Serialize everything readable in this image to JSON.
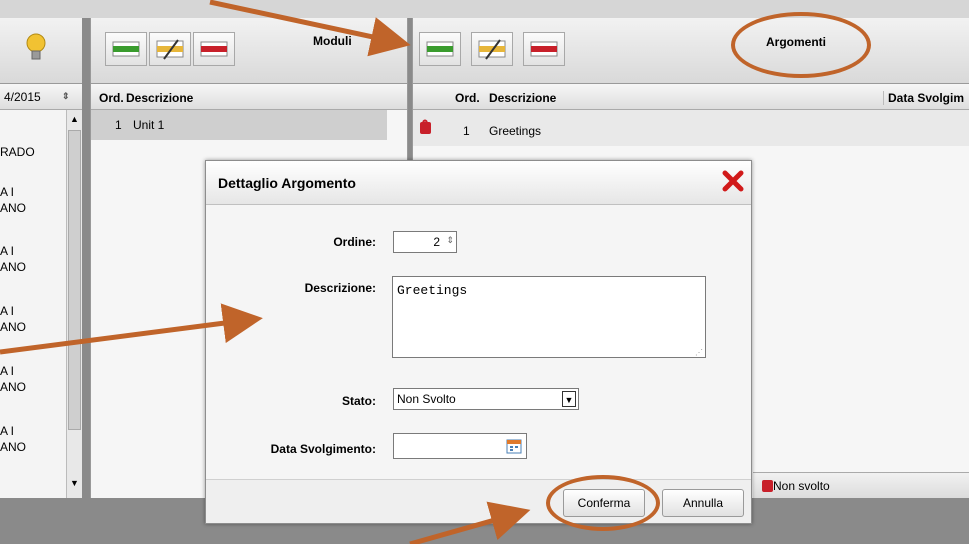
{
  "left_panel": {
    "date_value": "4/2015",
    "items": [
      "RADO",
      "A I",
      "ANO",
      "A I",
      "ANO",
      "A I",
      "ANO",
      "A I",
      "ANO",
      "A I",
      "ANO"
    ]
  },
  "moduli": {
    "title": "Moduli",
    "col_ord": "Ord.",
    "col_desc": "Descrizione",
    "rows": [
      {
        "ord": "1",
        "desc": "Unit 1"
      }
    ]
  },
  "argomenti": {
    "title": "Argomenti",
    "col_ord": "Ord.",
    "col_desc": "Descrizione",
    "col_date": "Data Svolgim",
    "rows": [
      {
        "ord": "1",
        "desc": "Greetings"
      }
    ],
    "legend_label": "Non svolto"
  },
  "dialog": {
    "title": "Dettaglio Argomento",
    "ordine_label": "Ordine:",
    "ordine_value": "2",
    "descrizione_label": "Descrizione:",
    "descrizione_value": "Greetings",
    "stato_label": "Stato:",
    "stato_value": "Non Svolto",
    "data_label": "Data Svolgimento:",
    "data_value": "",
    "confirm_label": "Conferma",
    "cancel_label": "Annulla"
  },
  "colors": {
    "annotation": "#c0642a",
    "red_icon": "#c8202a",
    "green_bar": "#3a9c2e"
  }
}
